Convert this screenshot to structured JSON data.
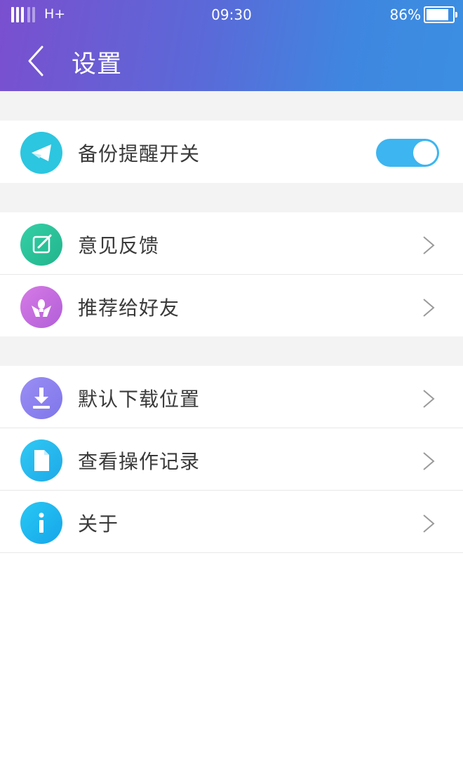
{
  "status_bar": {
    "network": "H+",
    "time": "09:30",
    "battery_percent": "86%",
    "battery_level": 0.86
  },
  "header": {
    "back_icon": "chevron-left-icon",
    "title": "设置"
  },
  "colors": {
    "header_gradient": [
      "#7a4fcf",
      "#3b8fe2"
    ],
    "toggle_on": "#3cb5f0",
    "section_gap": "#f3f3f3"
  },
  "sections": [
    {
      "items": [
        {
          "label": "备份提醒开关",
          "icon": "paper-plane-icon",
          "icon_color": "#2cc6e0",
          "toggle_on": true
        }
      ]
    },
    {
      "items": [
        {
          "label": "意见反馈",
          "icon": "edit-note-icon",
          "icon_color": "#28c59a"
        },
        {
          "label": "推荐给好友",
          "icon": "hands-gift-icon",
          "icon_color": "#c46fe0"
        }
      ]
    },
    {
      "items": [
        {
          "label": "默认下载位置",
          "icon": "download-icon",
          "icon_color": "#8d82f0"
        },
        {
          "label": "查看操作记录",
          "icon": "document-icon",
          "icon_color": "#28b6ee"
        },
        {
          "label": "关于",
          "icon": "info-icon",
          "icon_color": "#1fb9f0"
        }
      ]
    }
  ]
}
